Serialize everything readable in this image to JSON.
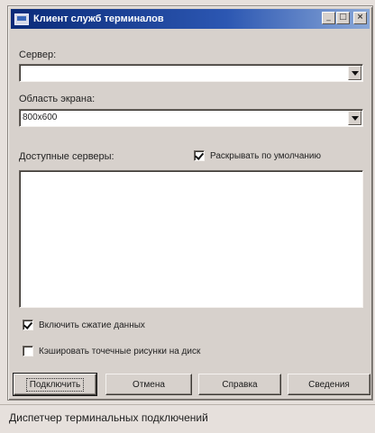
{
  "window": {
    "title": "Клиент служб терминалов",
    "controls": {
      "minimize": "_",
      "maximize": "□",
      "close": "×"
    }
  },
  "server": {
    "label": "Сервер:",
    "value": ""
  },
  "resolution": {
    "label": "Область экрана:",
    "value": "800x600"
  },
  "available_servers": {
    "label": "Доступные серверы:",
    "items": []
  },
  "expand_default": {
    "label": "Раскрывать по умолчанию",
    "checked": true
  },
  "compression": {
    "label": "Включить сжатие данных",
    "checked": true
  },
  "cache": {
    "label": "Кэшировать точечные рисунки на диск",
    "checked": false
  },
  "buttons": {
    "connect": "Подключить",
    "cancel": "Отмена",
    "help": "Справка",
    "about": "Сведения"
  },
  "caption": "Диспетчер терминальных подключений"
}
